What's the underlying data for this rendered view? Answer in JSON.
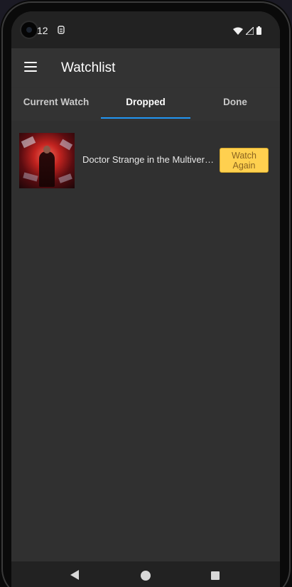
{
  "status_bar": {
    "time": "12",
    "icons": [
      "notification-icon",
      "wifi-icon",
      "signal-icon",
      "battery-icon"
    ]
  },
  "app_bar": {
    "title": "Watchlist",
    "menu_icon": "menu-icon"
  },
  "tabs": [
    {
      "label": "Current Watch",
      "active": false
    },
    {
      "label": "Dropped",
      "active": true
    },
    {
      "label": "Done",
      "active": false
    }
  ],
  "items": [
    {
      "title": "Doctor Strange in the Multiverse of Madness",
      "button_label": "Watch Again"
    }
  ],
  "colors": {
    "accent": "#2196f3",
    "button": "#ffd04f",
    "background": "#303030",
    "app_bar": "#333333"
  },
  "nav_bar": {
    "icons": [
      "back-icon",
      "home-icon",
      "recents-icon"
    ]
  }
}
